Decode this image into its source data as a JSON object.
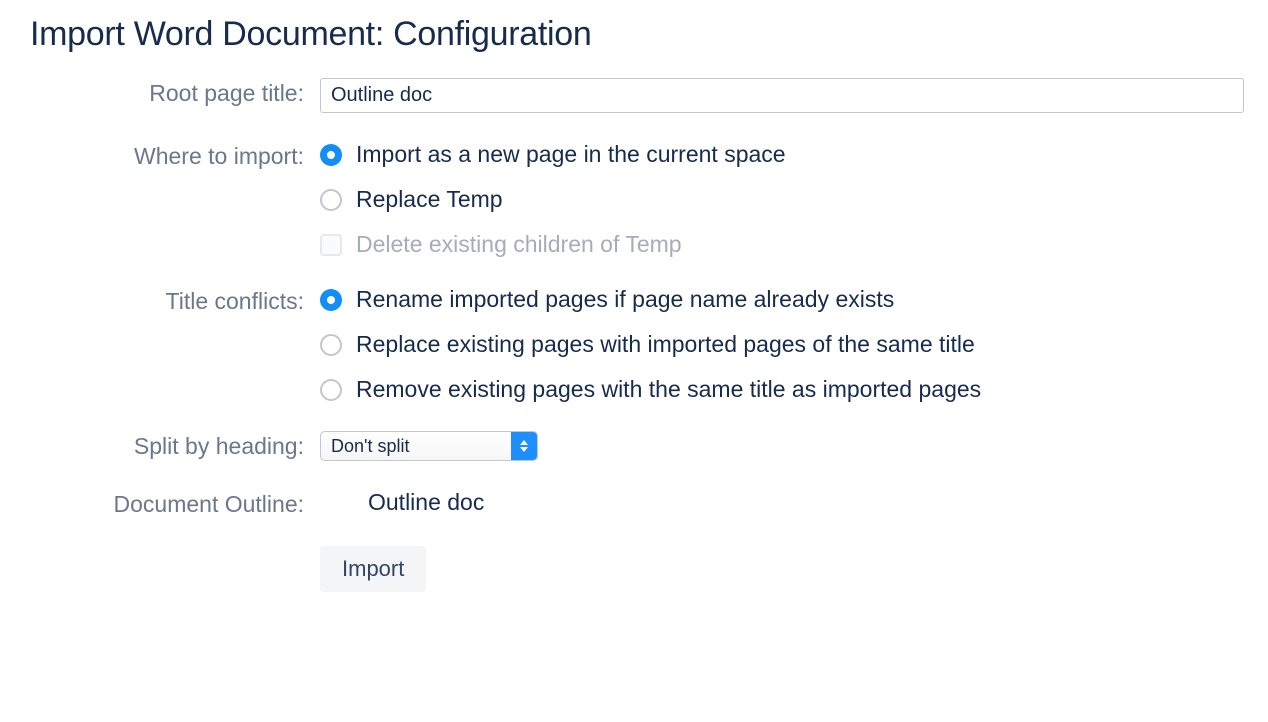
{
  "page_title": "Import Word Document: Configuration",
  "fields": {
    "root_page_title": {
      "label": "Root page title:",
      "value": "Outline doc"
    },
    "where_to_import": {
      "label": "Where to import:",
      "options": {
        "new_page": "Import as a new page in the current space",
        "replace": "Replace Temp",
        "delete_children": "Delete existing children of Temp"
      }
    },
    "title_conflicts": {
      "label": "Title conflicts:",
      "options": {
        "rename": "Rename imported pages if page name already exists",
        "replace": "Replace existing pages with imported pages of the same title",
        "remove": "Remove existing pages with the same title as imported pages"
      }
    },
    "split_by_heading": {
      "label": "Split by heading:",
      "selected": "Don't split"
    },
    "document_outline": {
      "label": "Document Outline:",
      "value": "Outline doc"
    }
  },
  "buttons": {
    "import": "Import"
  }
}
